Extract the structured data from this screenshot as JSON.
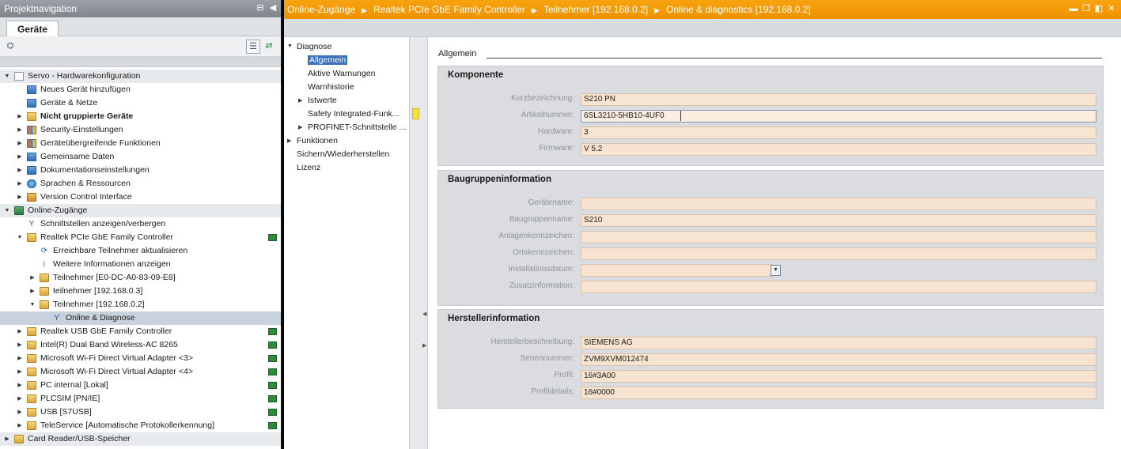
{
  "project_nav": {
    "title": "Projektnavigation",
    "tab": "Geräte",
    "tree": [
      {
        "label": "Servo - Hardwarekonfiguration",
        "level": 0,
        "expanded": true,
        "icon": "document-icon"
      },
      {
        "label": "Neues Gerät hinzufügen",
        "level": 1,
        "icon": "add-device-icon"
      },
      {
        "label": "Geräte & Netze",
        "level": 1,
        "icon": "devices-networks-icon"
      },
      {
        "label": "Nicht gruppierte Geräte",
        "level": 1,
        "collapsed": true,
        "bold": true,
        "icon": "folder-icon"
      },
      {
        "label": "Security-Einstellungen",
        "level": 1,
        "collapsed": true,
        "icon": "security-icon"
      },
      {
        "label": "Geräteübergreifende Funktionen",
        "level": 1,
        "collapsed": true,
        "icon": "cross-device-icon"
      },
      {
        "label": "Gemeinsame Daten",
        "level": 1,
        "collapsed": true,
        "icon": "common-data-icon"
      },
      {
        "label": "Dokumentationseinstellungen",
        "level": 1,
        "collapsed": true,
        "icon": "documentation-icon"
      },
      {
        "label": "Sprachen & Ressourcen",
        "level": 1,
        "collapsed": true,
        "icon": "languages-icon"
      },
      {
        "label": "Version Control Interface",
        "level": 1,
        "collapsed": true,
        "icon": "version-control-icon"
      },
      {
        "label": "Online-Zugänge",
        "level": 0,
        "expanded": true,
        "icon": "online-access-icon"
      },
      {
        "label": "Schnittstellen anzeigen/verbergen",
        "level": 1,
        "icon": "interface-icon"
      },
      {
        "label": "Realtek PCIe GbE Family Controller",
        "level": 1,
        "expanded": true,
        "icon": "network-adapter-icon",
        "status": true
      },
      {
        "label": "Erreichbare Teilnehmer aktualisieren",
        "level": 2,
        "icon": "refresh-nodes-icon"
      },
      {
        "label": "Weitere Informationen anzeigen",
        "level": 2,
        "icon": "info-icon"
      },
      {
        "label": "Teilnehmer [E0-DC-A0-83-09-E8]",
        "level": 2,
        "collapsed": true,
        "icon": "node-icon"
      },
      {
        "label": "teilnehmer [192.168.0.3]",
        "level": 2,
        "collapsed": true,
        "icon": "node-icon"
      },
      {
        "label": "Teilnehmer [192.168.0.2]",
        "level": 2,
        "expanded": true,
        "icon": "node-icon"
      },
      {
        "label": "Online & Diagnose",
        "level": 3,
        "icon": "online-diagnostics-icon",
        "selected": true
      },
      {
        "label": "Realtek USB GbE Family Controller",
        "level": 1,
        "collapsed": true,
        "icon": "network-adapter-icon",
        "status": true
      },
      {
        "label": "Intel(R) Dual Band Wireless-AC 8265",
        "level": 1,
        "collapsed": true,
        "icon": "network-adapter-icon",
        "status": true
      },
      {
        "label": "Microsoft Wi-Fi Direct Virtual Adapter <3>",
        "level": 1,
        "collapsed": true,
        "icon": "network-adapter-icon",
        "status": true
      },
      {
        "label": "Microsoft Wi-Fi Direct Virtual Adapter <4>",
        "level": 1,
        "collapsed": true,
        "icon": "network-adapter-icon",
        "status": true
      },
      {
        "label": "PC internal [Lokal]",
        "level": 1,
        "collapsed": true,
        "icon": "network-adapter-icon",
        "status": true
      },
      {
        "label": "PLCSIM [PN/IE]",
        "level": 1,
        "collapsed": true,
        "icon": "network-adapter-icon",
        "status": true
      },
      {
        "label": "USB [S7USB]",
        "level": 1,
        "collapsed": true,
        "icon": "network-adapter-icon",
        "status": true
      },
      {
        "label": "TeleService [Automatische Protokollerkennung]",
        "level": 1,
        "collapsed": true,
        "icon": "network-adapter-icon",
        "status": true
      },
      {
        "label": "Card Reader/USB-Speicher",
        "level": 0,
        "collapsed": true,
        "icon": "card-reader-icon"
      }
    ]
  },
  "editor": {
    "breadcrumb": [
      "Online-Zugänge",
      "Realtek PCIe GbE Family Controller",
      "Teilnehmer [192.168.0.2]",
      "Online & diagnostics [192.168.0.2]"
    ],
    "nav": [
      {
        "label": "Diagnose",
        "level": 0,
        "expanded": true
      },
      {
        "label": "Allgemein",
        "level": 1,
        "selected": true
      },
      {
        "label": "Aktive Warnungen",
        "level": 1
      },
      {
        "label": "Warnhistorie",
        "level": 1
      },
      {
        "label": "Istwerte",
        "level": 1,
        "collapsed": true
      },
      {
        "label": "Safety Integrated-Funk...",
        "level": 1
      },
      {
        "label": "PROFINET-Schnittstelle ...",
        "level": 1,
        "collapsed": true
      },
      {
        "label": "Funktionen",
        "level": 0,
        "collapsed": true
      },
      {
        "label": "Sichern/Wiederherstellen",
        "level": 0
      },
      {
        "label": "Lizenz",
        "level": 0
      }
    ],
    "content_heading": "Allgemein",
    "sections": [
      {
        "title": "Komponente",
        "fields": [
          {
            "label": "Kurzbezeichnung:",
            "value": "S210 PN"
          },
          {
            "label": "Artikelnummer:",
            "value": "6SL3210-5HB10-4UF0"
          },
          {
            "label": "Hardware:",
            "value": "3"
          },
          {
            "label": "Firmware:",
            "value": "V 5.2"
          }
        ]
      },
      {
        "title": "Baugruppeninformation",
        "fields": [
          {
            "label": "Gerätename:",
            "value": ""
          },
          {
            "label": "Baugruppenname:",
            "value": "S210"
          },
          {
            "label": "Anlagenkennzeichen:",
            "value": ""
          },
          {
            "label": "Ortskennzeichen:",
            "value": ""
          },
          {
            "label": "Installationsdatum:",
            "value": ""
          },
          {
            "label": "Zusatzinformation:",
            "value": ""
          }
        ]
      },
      {
        "title": "Herstellerinformation",
        "fields": [
          {
            "label": "Herstellerbeschreibung:",
            "value": "SIEMENS AG"
          },
          {
            "label": "Seriennummer:",
            "value": "ZVM9XVM012474"
          },
          {
            "label": "Profil:",
            "value": "16#3A00"
          },
          {
            "label": "Profildetails:",
            "value": "16#0000"
          }
        ]
      }
    ]
  },
  "colors": {
    "title_orange": "#f29a05",
    "field_fill": "#f7e4d0",
    "section_gray": "#dadcdf",
    "status_green": "#2e8b3a",
    "selection_blue": "#3b6fb8"
  }
}
